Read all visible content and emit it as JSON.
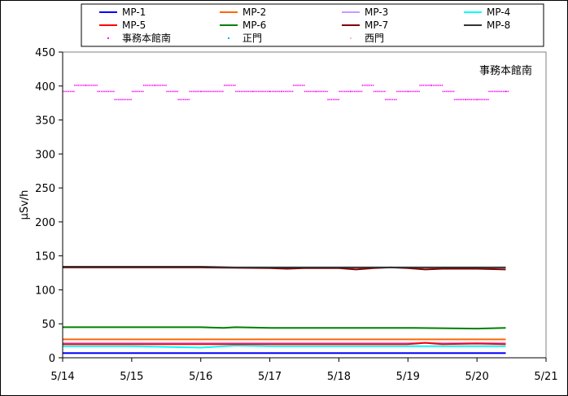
{
  "chart_data": {
    "type": "line",
    "title": "事務本館南",
    "ylabel": "μSv/h",
    "ylim": [
      0,
      450
    ],
    "yticks": [
      0,
      50,
      100,
      150,
      200,
      250,
      300,
      350,
      400,
      450
    ],
    "xlim": [
      "5/14",
      "5/21"
    ],
    "xticks": [
      "5/14",
      "5/15",
      "5/16",
      "5/17",
      "5/18",
      "5/19",
      "5/20",
      "5/21"
    ],
    "data_end": "5/20 10:00",
    "grid": false,
    "legend_position": "top",
    "series": [
      {
        "name": "MP-1",
        "color": "#0000ff",
        "style": "line",
        "x": [
          "5/14",
          "5/20 10:00"
        ],
        "values": [
          7,
          7
        ]
      },
      {
        "name": "MP-2",
        "color": "#ff6600",
        "style": "line",
        "x": [
          "5/14",
          "5/20 10:00"
        ],
        "values": [
          27,
          27
        ]
      },
      {
        "name": "MP-3",
        "color": "#cc99ff",
        "style": "line",
        "x": [
          "5/14",
          "5/20 10:00"
        ],
        "values": [
          22,
          22
        ]
      },
      {
        "name": "MP-4",
        "color": "#00ffff",
        "style": "line",
        "x": [
          "5/14",
          "5/15",
          "5/16",
          "5/16 12:00",
          "5/17",
          "5/18",
          "5/19",
          "5/20",
          "5/20 10:00"
        ],
        "values": [
          17,
          17,
          15,
          18,
          17,
          17,
          17,
          17,
          17
        ]
      },
      {
        "name": "MP-5",
        "color": "#ff0000",
        "style": "line",
        "x": [
          "5/14",
          "5/19",
          "5/19 06:00",
          "5/19 12:00",
          "5/20",
          "5/20 10:00"
        ],
        "values": [
          20,
          20,
          22,
          20,
          21,
          20
        ]
      },
      {
        "name": "MP-6",
        "color": "#008000",
        "style": "line",
        "x": [
          "5/14",
          "5/15",
          "5/16",
          "5/16 08:00",
          "5/16 12:00",
          "5/17",
          "5/18",
          "5/19",
          "5/20",
          "5/20 10:00"
        ],
        "values": [
          45,
          45,
          45,
          44,
          45,
          44,
          44,
          44,
          43,
          44
        ]
      },
      {
        "name": "MP-7",
        "color": "#800000",
        "style": "line",
        "x": [
          "5/14",
          "5/15",
          "5/16",
          "5/17",
          "5/17 06:00",
          "5/17 12:00",
          "5/18",
          "5/18 06:00",
          "5/18 12:00",
          "5/18 18:00",
          "5/19",
          "5/19 06:00",
          "5/19 12:00",
          "5/20",
          "5/20 10:00"
        ],
        "values": [
          133,
          133,
          133,
          132,
          131,
          132,
          132,
          130,
          132,
          133,
          132,
          130,
          131,
          131,
          130
        ]
      },
      {
        "name": "MP-8",
        "color": "#333333",
        "style": "line",
        "x": [
          "5/14",
          "5/15",
          "5/16",
          "5/16 12:00",
          "5/17",
          "5/18",
          "5/19",
          "5/20",
          "5/20 10:00"
        ],
        "values": [
          134,
          134,
          134,
          133,
          133,
          133,
          133,
          133,
          133
        ]
      },
      {
        "name": "事務本館南",
        "color": "#ff00ff",
        "style": "dots",
        "x": [
          "5/14",
          "5/14 04:00",
          "5/14 08:00",
          "5/14 12:00",
          "5/14 18:00",
          "5/15",
          "5/15 04:00",
          "5/15 08:00",
          "5/15 12:00",
          "5/15 16:00",
          "5/15 20:00",
          "5/16",
          "5/16 08:00",
          "5/16 12:00",
          "5/16 18:00",
          "5/17",
          "5/17 04:00",
          "5/17 08:00",
          "5/17 12:00",
          "5/17 16:00",
          "5/17 20:00",
          "5/18",
          "5/18 04:00",
          "5/18 08:00",
          "5/18 12:00",
          "5/18 16:00",
          "5/18 20:00",
          "5/19",
          "5/19 04:00",
          "5/19 08:00",
          "5/19 12:00",
          "5/19 16:00",
          "5/19 20:00",
          "5/20",
          "5/20 04:00",
          "5/20 10:00"
        ],
        "values": [
          392,
          401,
          401,
          392,
          380,
          392,
          401,
          401,
          392,
          380,
          392,
          392,
          401,
          392,
          392,
          392,
          392,
          401,
          392,
          392,
          380,
          392,
          392,
          401,
          392,
          380,
          392,
          392,
          401,
          401,
          392,
          380,
          380,
          380,
          392,
          392
        ]
      },
      {
        "name": "正門",
        "color": "#00b0f0",
        "style": "dots",
        "x": [],
        "values": []
      },
      {
        "name": "西門",
        "color": "#ffb6c1",
        "style": "dots",
        "x": [],
        "values": []
      }
    ]
  }
}
